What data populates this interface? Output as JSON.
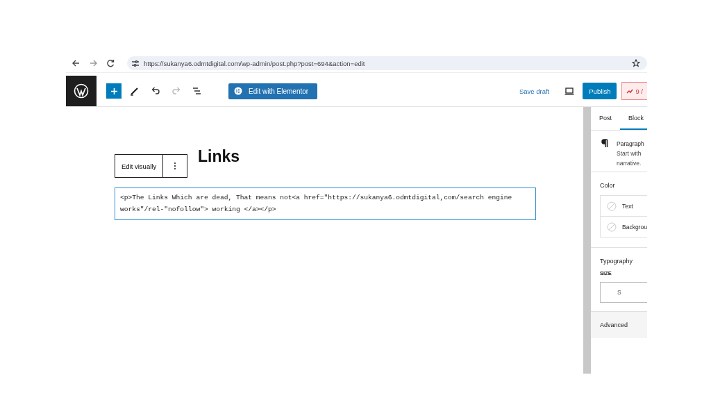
{
  "browser": {
    "url": "https://sukanya6.odmtdigital.com/wp-admin/post.php?post=694&action=edit"
  },
  "toolbar": {
    "elementor_button": "Edit with Elementor",
    "save_draft": "Save draft",
    "publish": "Publish",
    "score": "9 /"
  },
  "editor": {
    "title": "Links",
    "popover": {
      "label": "Edit visually"
    },
    "code_lines": [
      "<p>The Links Which are dead, That means not<a href=\"https://sukanya6.odmtdigital,com/search engine",
      "works\"/rel-\"nofollow\"> working </a></p>"
    ]
  },
  "sidebar": {
    "tabs": [
      {
        "label": "Post",
        "selected": false
      },
      {
        "label": "Block",
        "selected": true
      }
    ],
    "block": {
      "name": "Paragraph",
      "description_lines": [
        "Start with",
        "narrative."
      ]
    },
    "color": {
      "heading": "Color",
      "items": [
        "Text",
        "Backgrou"
      ]
    },
    "typography": {
      "heading": "Typography",
      "size_label": "SIZE",
      "size_value": "S"
    },
    "advanced": "Advanced"
  }
}
